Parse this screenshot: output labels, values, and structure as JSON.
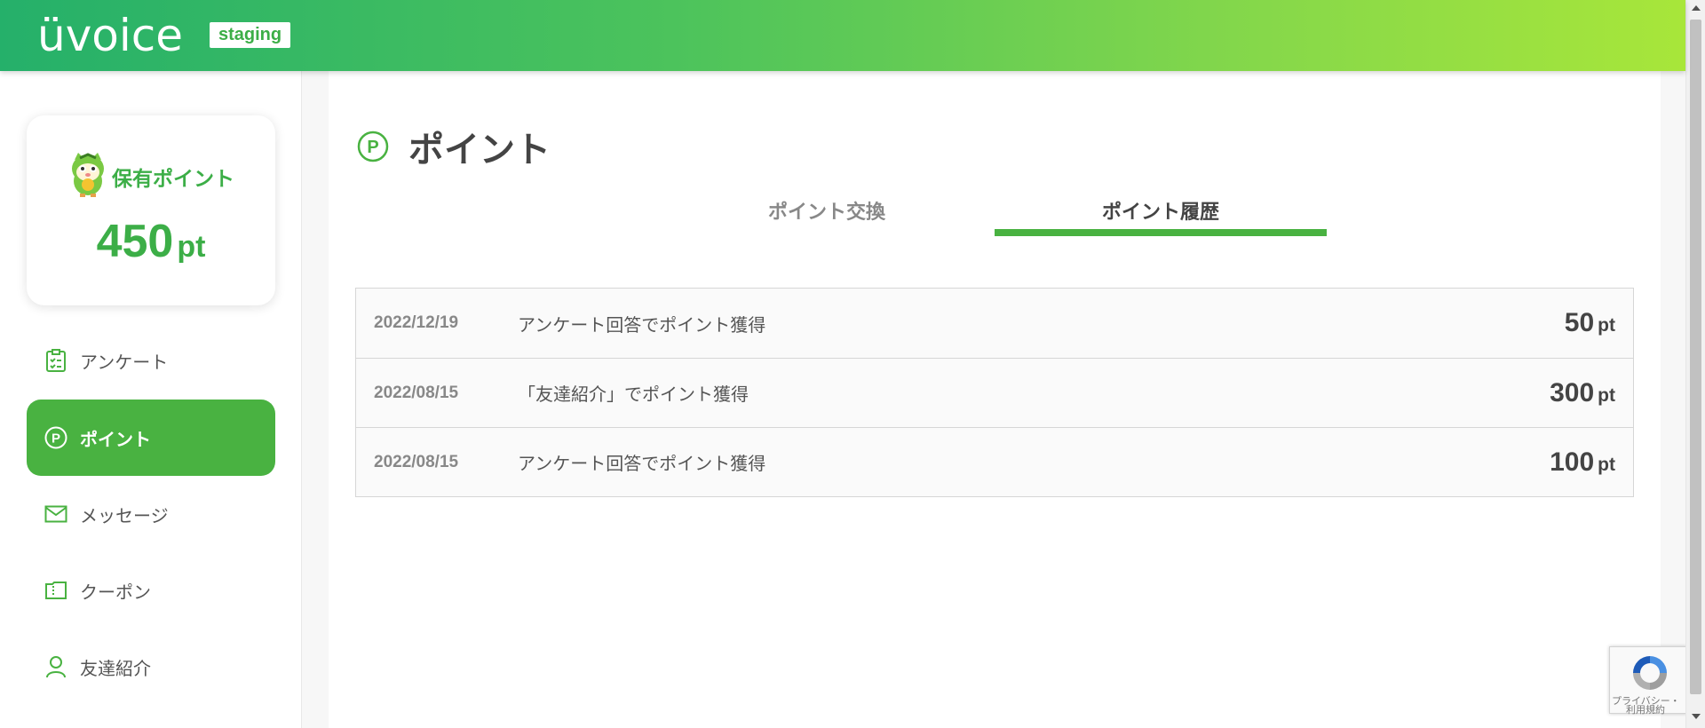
{
  "header": {
    "logo": "üvoice",
    "env_badge": "staging"
  },
  "points_card": {
    "title": "保有ポイント",
    "value": "450",
    "unit": "pt"
  },
  "nav": {
    "items": [
      {
        "label": "アンケート",
        "icon": "clipboard-check-icon",
        "active": false
      },
      {
        "label": "ポイント",
        "icon": "point-p-icon",
        "active": true
      },
      {
        "label": "メッセージ",
        "icon": "envelope-icon",
        "active": false
      },
      {
        "label": "クーポン",
        "icon": "coupon-ticket-icon",
        "active": false
      },
      {
        "label": "友達紹介",
        "icon": "person-icon",
        "active": false
      }
    ]
  },
  "page": {
    "title": "ポイント",
    "tabs": [
      {
        "label": "ポイント交換",
        "active": false
      },
      {
        "label": "ポイント履歴",
        "active": true
      }
    ]
  },
  "history": [
    {
      "date": "2022/12/19",
      "description": "アンケート回答でポイント獲得",
      "amount": "50",
      "unit": "pt"
    },
    {
      "date": "2022/08/15",
      "description": "「友達紹介」でポイント獲得",
      "amount": "300",
      "unit": "pt"
    },
    {
      "date": "2022/08/15",
      "description": "アンケート回答でポイント獲得",
      "amount": "100",
      "unit": "pt"
    }
  ],
  "recaptcha": {
    "line1": "プライバシー・",
    "line2": "利用規約"
  },
  "colors": {
    "accent": "#49b241",
    "header_gradient_start": "#25b06a",
    "header_gradient_end": "#a8e63a"
  }
}
